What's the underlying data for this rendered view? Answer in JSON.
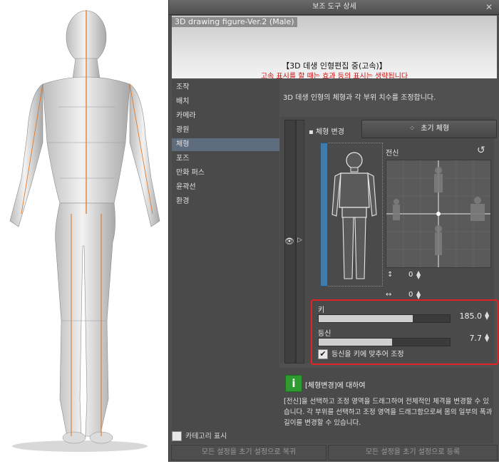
{
  "dialog": {
    "title": "보조 도구 상세",
    "close_icon": "close-icon"
  },
  "banner": {
    "model_name": "3D drawing figure-Ver.2 (Male)",
    "mode_text": "【3D 데생 인형편집 중(고속)】",
    "warning_text": "고속 표시를 할 때는 효과 등의 표시는 생략됩니다"
  },
  "categories": {
    "items": [
      {
        "label": "조작"
      },
      {
        "label": "배치"
      },
      {
        "label": "카메라"
      },
      {
        "label": "광원"
      },
      {
        "label": "체형",
        "selected": true
      },
      {
        "label": "포즈"
      },
      {
        "label": "만화 퍼스"
      },
      {
        "label": "윤곽선"
      },
      {
        "label": "환경"
      }
    ],
    "show_category_label": "카테고리 표시"
  },
  "panel": {
    "description": "3D 데생 인형의 체형과 각 부위 치수를 조정합니다.",
    "body_shape_label": "체형 변경",
    "reset_button_label": "초기 체형",
    "whole_body_label": "전신",
    "vertical_value": "0",
    "horizontal_value": "0",
    "height_label": "키",
    "height_value": "185.0",
    "height_fraction": 0.72,
    "head_ratio_label": "등신",
    "head_ratio_value": "7.7",
    "head_ratio_fraction": 0.56,
    "fit_checkbox_label": "등신을 키에 맞추어 조정",
    "fit_checked": true
  },
  "info": {
    "title": "[체형변경]에 대하여",
    "body": "[전신]을 선택하고 조정 영역을 드래그하여 전체적인 체격을 변경할 수 있습니다. 각 부위를 선택하고 조정 영역을 드래그함으로써 몸의 일부의 폭과 길이를 변경할 수 있습니다."
  },
  "footer": {
    "restore_label": "모든 설정을 초기 설정으로 복귀",
    "register_label": "모든 설정을 초기 설정으로 등록"
  },
  "colors": {
    "accent_blue": "#3f7cab",
    "highlight_red": "#e32323",
    "info_green": "#2f9a2f",
    "guide_orange": "#e0701a"
  }
}
